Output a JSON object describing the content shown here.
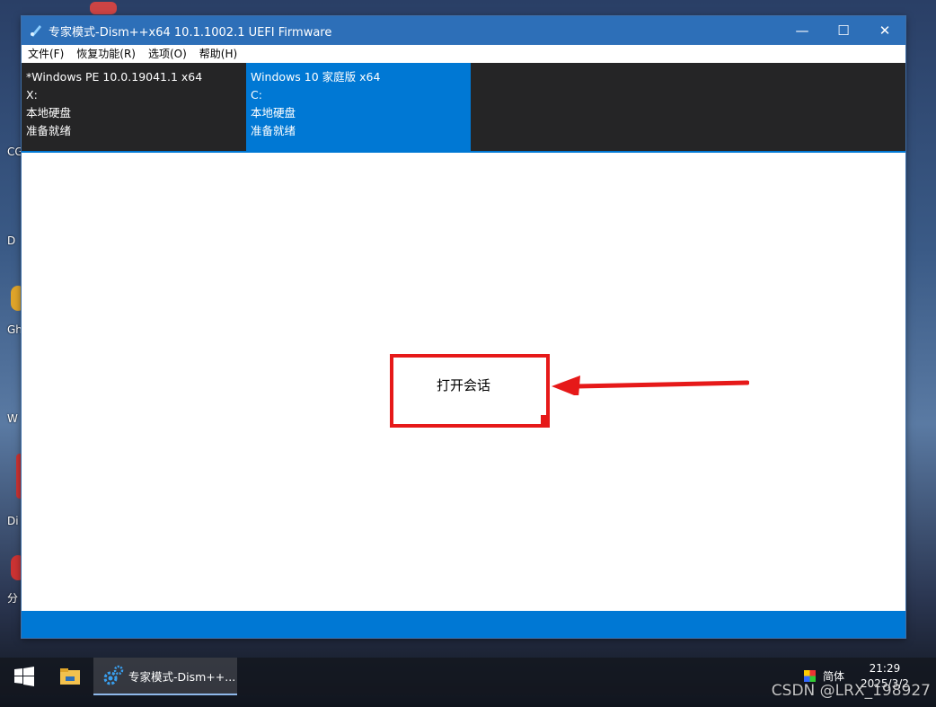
{
  "window": {
    "title": "专家模式-Dism++x64 10.1.1002.1 UEFI Firmware",
    "controls": {
      "minimize": "—",
      "maximize": "☐",
      "close": "✕"
    }
  },
  "menu": [
    "文件(F)",
    "恢复功能(R)",
    "选项(O)",
    "帮助(H)"
  ],
  "sessions": [
    {
      "name": "*Windows PE 10.0.19041.1 x64",
      "drive": "X:",
      "type": "本地硬盘",
      "status": "准备就绪",
      "active": false
    },
    {
      "name": "Windows 10 家庭版 x64",
      "drive": "C:",
      "type": "本地硬盘",
      "status": "准备就绪",
      "active": true
    }
  ],
  "main": {
    "open_session_label": "打开会话"
  },
  "desktop": {
    "icon_labels": [
      "CG",
      "D",
      "Gh",
      "W",
      "Di",
      "分"
    ]
  },
  "taskbar": {
    "app_label": "专家模式-Dism++...",
    "ime": "简体",
    "time": "21:29",
    "date": "2025/3/2"
  },
  "watermark": "CSDN @LRX_198927",
  "colors": {
    "accent": "#0078d4",
    "titlebar": "#2d6fb8",
    "annotation": "#e61919",
    "session_bg": "#252526"
  }
}
